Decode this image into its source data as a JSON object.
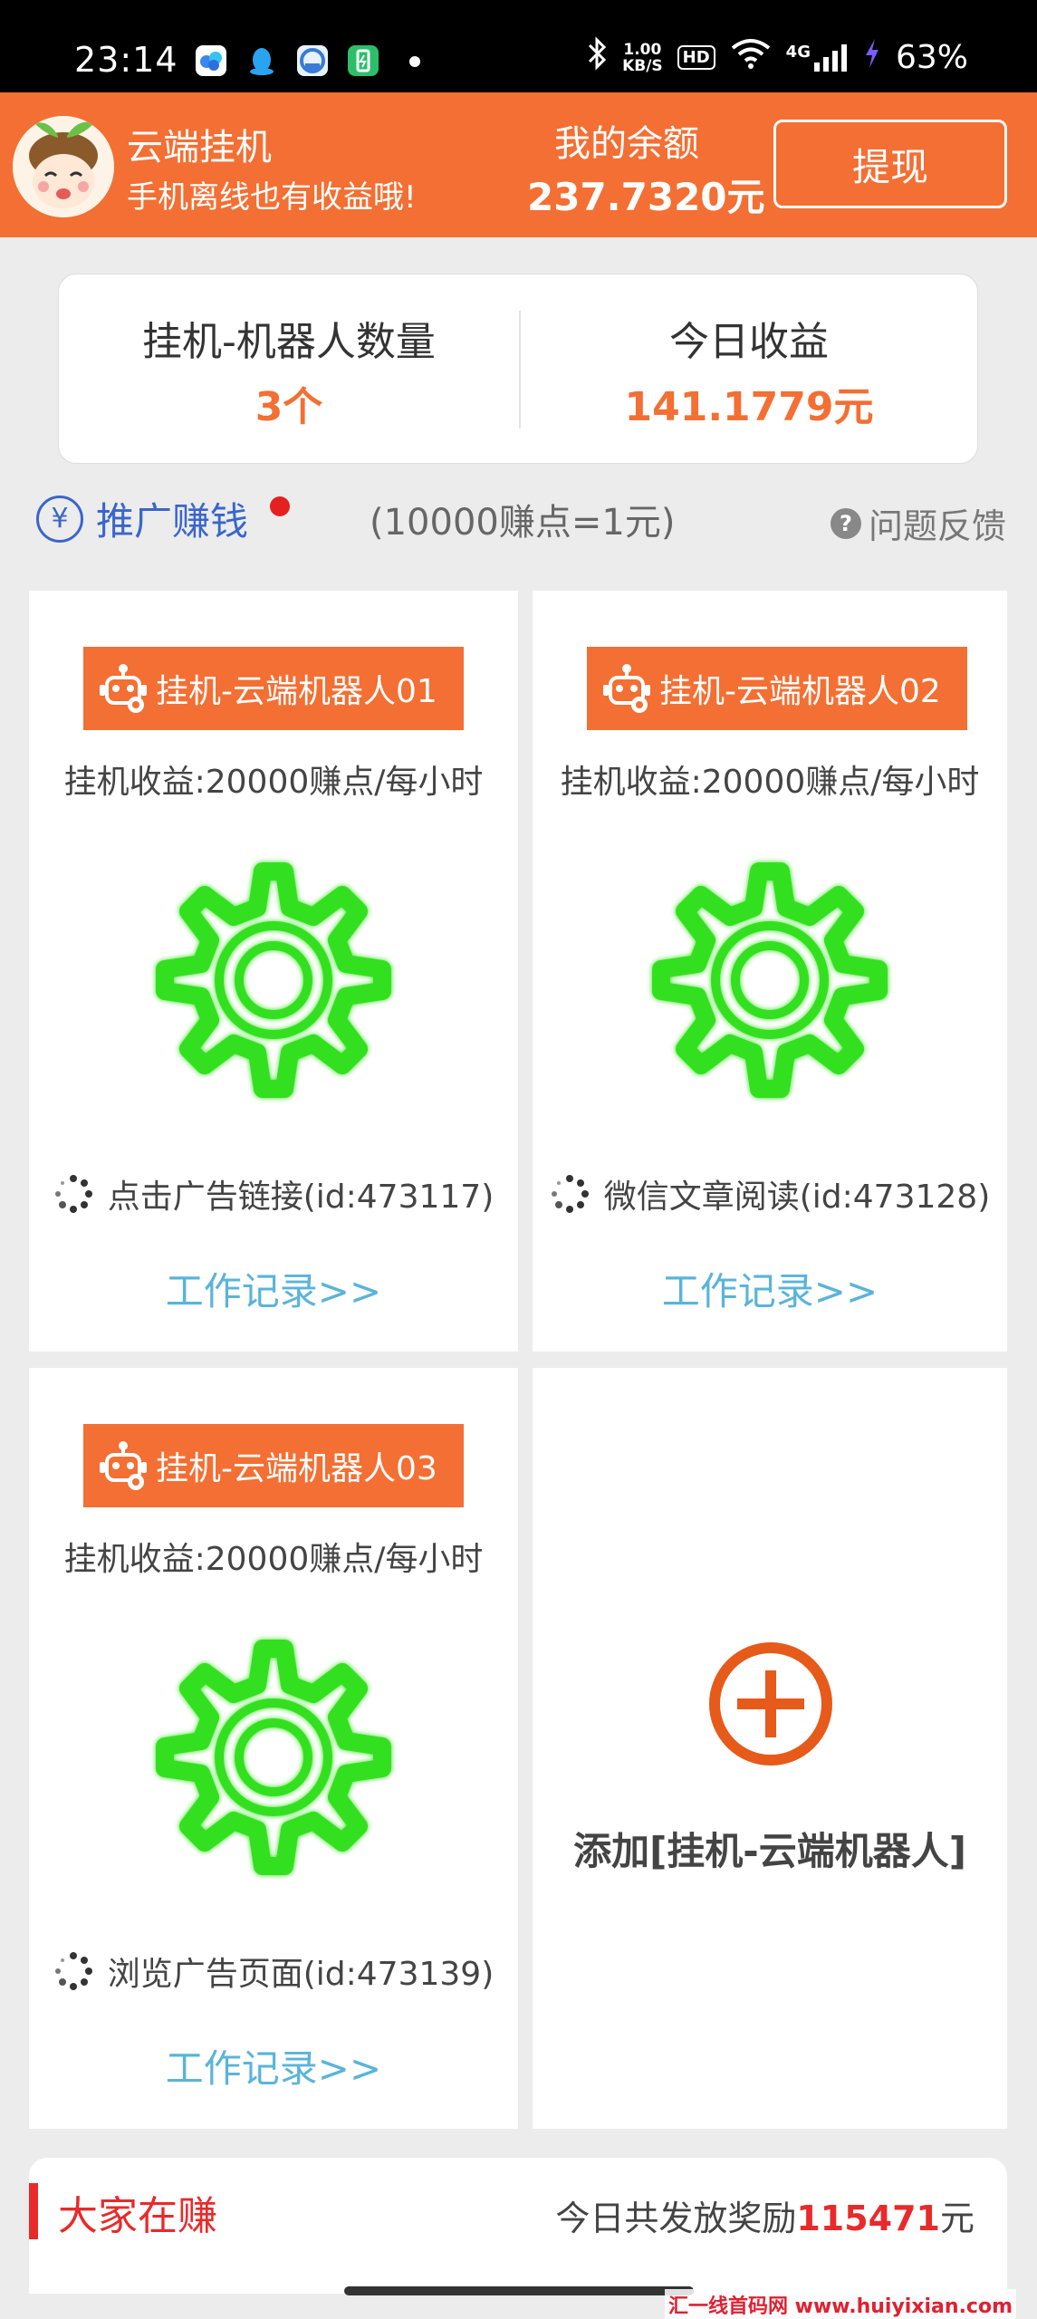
{
  "status_bar": {
    "time": "23:14",
    "net_speed_value": "1.00",
    "net_speed_unit": "KB/S",
    "hd": "HD",
    "network": "4G",
    "battery": "63%"
  },
  "header": {
    "app_title": "云端挂机",
    "app_subtitle": "手机离线也有收益哦!",
    "balance_label": "我的余额",
    "balance_value": "237.7320元",
    "withdraw_label": "提现"
  },
  "stats": {
    "robot_count_label": "挂机-机器人数量",
    "robot_count_value": "3个",
    "today_income_label": "今日收益",
    "today_income_value": "141.1779元"
  },
  "promo": {
    "icon": "¥",
    "label": "推广赚钱",
    "rate": "(10000赚点=1元)",
    "feedback_icon": "?",
    "feedback_label": "问题反馈"
  },
  "robots": [
    {
      "name": "挂机-云端机器人01",
      "earning": "挂机收益:20000赚点/每小时",
      "task": "点击广告链接(id:473117)",
      "log_label": "工作记录>>"
    },
    {
      "name": "挂机-云端机器人02",
      "earning": "挂机收益:20000赚点/每小时",
      "task": "微信文章阅读(id:473128)",
      "log_label": "工作记录>>"
    },
    {
      "name": "挂机-云端机器人03",
      "earning": "挂机收益:20000赚点/每小时",
      "task": "浏览广告页面(id:473139)",
      "log_label": "工作记录>>"
    }
  ],
  "add_robot": {
    "label": "添加[挂机-云端机器人]"
  },
  "everyone_earning": {
    "title": "大家在赚",
    "reward_prefix": "今日共发放奖励",
    "reward_value": "115471",
    "reward_unit": "元"
  },
  "watermark": "汇一线首码网 www.huiyixian.com",
  "colors": {
    "accent": "#f36f33",
    "link": "#5ab4d8",
    "promo_blue": "#3a66c9",
    "gear_green": "#33e01f",
    "highlight_red": "#e82a2a"
  }
}
